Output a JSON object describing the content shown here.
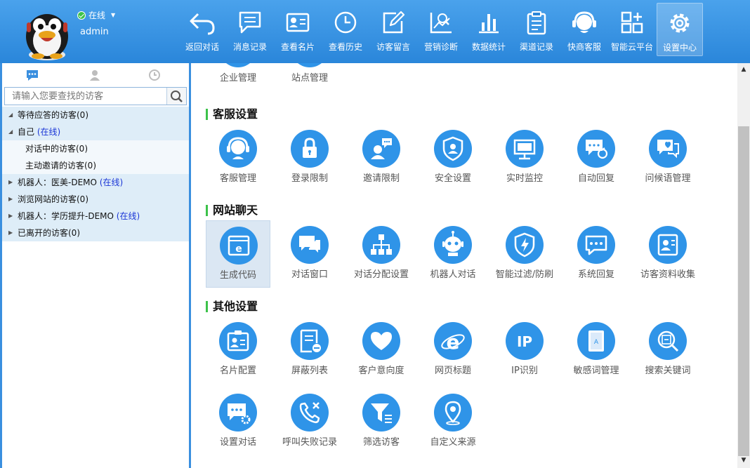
{
  "header": {
    "status": "在线",
    "username": "admin",
    "nav": [
      {
        "label": "返回对话",
        "icon": "return-arrow-icon"
      },
      {
        "label": "消息记录",
        "icon": "message-record-icon"
      },
      {
        "label": "查看名片",
        "icon": "business-card-icon"
      },
      {
        "label": "查看历史",
        "icon": "history-clock-icon"
      },
      {
        "label": "访客留言",
        "icon": "edit-note-icon"
      },
      {
        "label": "营销诊断",
        "icon": "marketing-diagnosis-icon"
      },
      {
        "label": "数据统计",
        "icon": "bar-chart-icon"
      },
      {
        "label": "渠道记录",
        "icon": "clipboard-icon"
      },
      {
        "label": "快商客服",
        "icon": "headset-service-icon"
      },
      {
        "label": "智能云平台",
        "icon": "app-grid-icon"
      },
      {
        "label": "设置中心",
        "icon": "gear-icon"
      }
    ]
  },
  "sidebar": {
    "search_placeholder": "请输入您要查找的访客",
    "tree": {
      "waiting": "等待应答的访客(0)",
      "self": "自己",
      "self_status": "(在线)",
      "talking": "对话中的访客(0)",
      "invited": "主动邀请的访客(0)",
      "robot1": "机器人：医美-DEMO",
      "robot1_status": "(在线)",
      "browsing": "浏览网站的访客(0)",
      "robot2": "机器人：学历提升-DEMO",
      "robot2_status": "(在线)",
      "left": "已离开的访客(0)"
    }
  },
  "content": {
    "top_row": [
      {
        "label": "企业管理"
      },
      {
        "label": "站点管理"
      }
    ],
    "sections": [
      {
        "title": "客服设置",
        "items": [
          {
            "label": "客服管理",
            "icon": "agent-headset-icon"
          },
          {
            "label": "登录限制",
            "icon": "lock-icon"
          },
          {
            "label": "邀请限制",
            "icon": "invite-user-icon"
          },
          {
            "label": "安全设置",
            "icon": "security-shield-icon"
          },
          {
            "label": "实时监控",
            "icon": "monitor-icon"
          },
          {
            "label": "自动回复",
            "icon": "auto-reply-icon"
          },
          {
            "label": "问候语管理",
            "icon": "greeting-chat-icon"
          }
        ]
      },
      {
        "title": "网站聊天",
        "items": [
          {
            "label": "生成代码",
            "icon": "browser-code-icon"
          },
          {
            "label": "对话窗口",
            "icon": "chat-window-icon"
          },
          {
            "label": "对话分配设置",
            "icon": "distribution-tree-icon"
          },
          {
            "label": "机器人对话",
            "icon": "robot-icon"
          },
          {
            "label": "智能过滤/防刷",
            "icon": "filter-shield-icon"
          },
          {
            "label": "系统回复",
            "icon": "system-reply-icon"
          },
          {
            "label": "访客资料收集",
            "icon": "profile-card-icon"
          }
        ]
      },
      {
        "title": "其他设置",
        "items": [
          {
            "label": "名片配置",
            "icon": "card-config-icon"
          },
          {
            "label": "屏蔽列表",
            "icon": "block-list-icon"
          },
          {
            "label": "客户意向度",
            "icon": "heart-icon"
          },
          {
            "label": "网页标题",
            "icon": "web-browser-icon"
          },
          {
            "label": "IP识别",
            "icon": "ip-icon"
          },
          {
            "label": "敏感词管理",
            "icon": "sensitive-word-icon"
          },
          {
            "label": "搜索关键词",
            "icon": "keyword-search-icon"
          },
          {
            "label": "设置对话",
            "icon": "chat-settings-icon"
          },
          {
            "label": "呼叫失败记录",
            "icon": "call-failed-icon"
          },
          {
            "label": "筛选访客",
            "icon": "funnel-filter-icon"
          },
          {
            "label": "自定义来源",
            "icon": "location-pin-icon"
          }
        ]
      }
    ]
  },
  "colors": {
    "header_top": "#4aa2ec",
    "header_bottom": "#2a86da",
    "icon_circle": "#2f94e8",
    "section_marker": "#3cc24a",
    "online_text": "#1a35d6",
    "tree_row_bg": "#deedf8",
    "selected_tile_bg": "#dbe7f3"
  }
}
